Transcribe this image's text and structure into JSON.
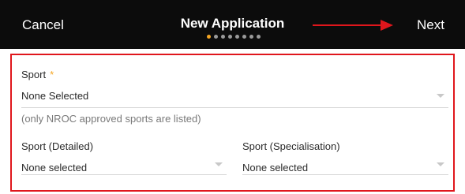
{
  "header": {
    "cancel_label": "Cancel",
    "title": "New Application",
    "next_label": "Next",
    "step_count": 8,
    "current_step": 1
  },
  "colors": {
    "header_bg": "#0c0c0c",
    "accent": "#f5a623",
    "annotation_red": "#e0161c"
  },
  "form": {
    "sport": {
      "label": "Sport",
      "required_marker": "*",
      "value": "None Selected",
      "helper": "(only NROC approved sports are listed)"
    },
    "sport_detailed": {
      "label": "Sport (Detailed)",
      "value": "None selected"
    },
    "sport_specialisation": {
      "label": "Sport (Specialisation)",
      "value": "None selected"
    }
  }
}
